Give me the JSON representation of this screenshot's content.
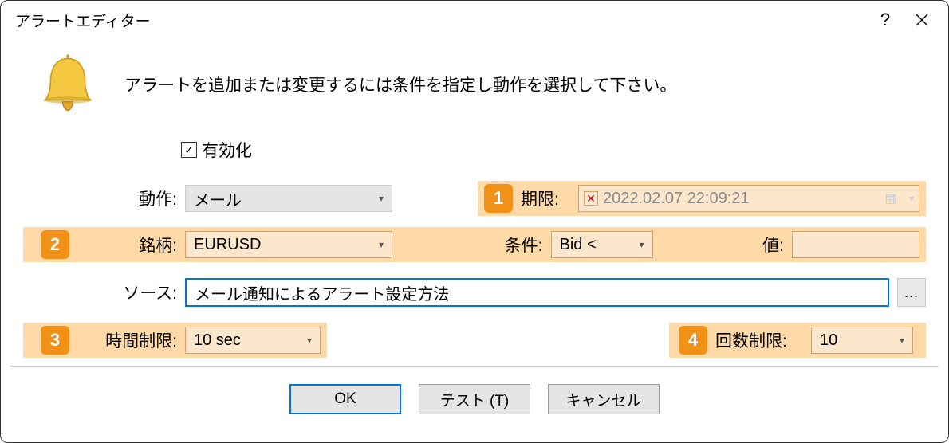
{
  "title": "アラートエディター",
  "instructions": "アラートを追加または変更するには条件を指定し動作を選択して下さい。",
  "form": {
    "enable_label": "有効化",
    "action_label": "動作:",
    "action_value": "メール",
    "expiration_label": "期限:",
    "expiration_value": "2022.02.07 22:09:21",
    "symbol_label": "銘柄:",
    "symbol_value": "EURUSD",
    "condition_label": "条件:",
    "condition_value": "Bid <",
    "value_label": "値:",
    "value_value": "",
    "source_label": "ソース:",
    "source_value": "メール通知によるアラート設定方法",
    "timeout_label": "時間制限:",
    "timeout_value": "10 sec",
    "max_iter_label": "回数制限:",
    "max_iter_value": "10"
  },
  "badges": {
    "b1": "1",
    "b2": "2",
    "b3": "3",
    "b4": "4"
  },
  "buttons": {
    "ok": "OK",
    "test": "テスト (T)",
    "cancel": "キャンセル"
  }
}
